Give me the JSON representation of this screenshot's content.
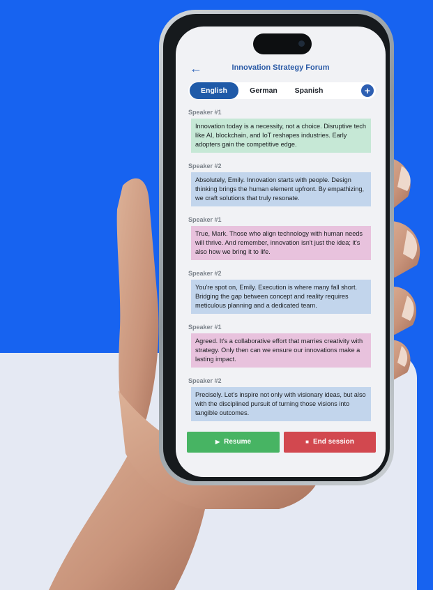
{
  "header": {
    "back_icon": "arrow-left-icon",
    "title": "Innovation Strategy Forum"
  },
  "tabs": [
    {
      "label": "English",
      "active": true
    },
    {
      "label": "German",
      "active": false
    },
    {
      "label": "Spanish",
      "active": false
    }
  ],
  "add_icon": "plus-icon",
  "messages": [
    {
      "speaker": "Speaker #1",
      "text": "Innovation today is a necessity, not a choice. Disruptive tech like AI, blockchain, and IoT reshapes industries. Early adopters gain the competitive edge."
    },
    {
      "speaker": "Speaker #2",
      "text": "Absolutely, Emily. Innovation starts with people. Design thinking brings the human element upfront. By empathizing, we craft solutions that truly resonate."
    },
    {
      "speaker": "Speaker #1",
      "text": "True, Mark. Those who align technology with human needs will thrive. And remember, innovation isn't just the idea; it's also how we bring it to life."
    },
    {
      "speaker": "Speaker #2",
      "text": "You're spot on, Emily. Execution is where many fall short. Bridging the gap between concept and reality requires meticulous planning and a dedicated team."
    },
    {
      "speaker": "Speaker #1",
      "text": "Agreed. It's a collaborative effort that marries creativity with strategy. Only then can we ensure our innovations make a lasting impact."
    },
    {
      "speaker": "Speaker #2",
      "text": "Precisely. Let's inspire not only with visionary ideas, but also with the disciplined pursuit of turning those visions into tangible outcomes."
    }
  ],
  "actions": {
    "resume": {
      "icon": "play-icon",
      "label": "Resume"
    },
    "end": {
      "icon": "stop-icon",
      "label": "End session"
    }
  },
  "colors": {
    "background_blue": "#1763f0",
    "panel": "#e5e9f3",
    "msg_green": "#c6e8d6",
    "msg_blue": "#c2d5ec",
    "msg_pink": "#e8c2dd",
    "resume": "#47b463",
    "end": "#d2484f"
  }
}
